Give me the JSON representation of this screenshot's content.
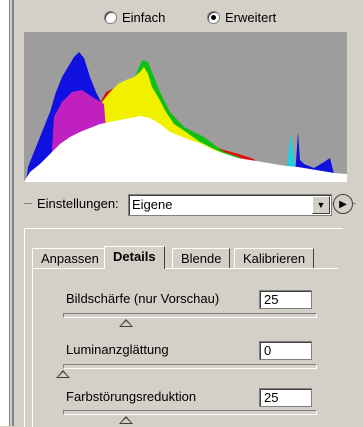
{
  "mode": {
    "options": [
      {
        "label": "Einfach",
        "selected": false
      },
      {
        "label": "Erweitert",
        "selected": true
      }
    ]
  },
  "histogram": {
    "channels": [
      "blue",
      "red",
      "green",
      "yellow",
      "cyan",
      "magenta",
      "white"
    ]
  },
  "settings": {
    "label": "Einstellungen:",
    "value": "Eigene",
    "menu_icon": "flyout-menu-icon"
  },
  "tabs": [
    {
      "label": "Anpassen",
      "active": false
    },
    {
      "label": "Details",
      "active": true
    },
    {
      "label": "Blende",
      "active": false
    },
    {
      "label": "Kalibrieren",
      "active": false
    }
  ],
  "controls": [
    {
      "label": "Bildschärfe (nur Vorschau)",
      "value": "25",
      "slider_value": 25,
      "slider_max": 100
    },
    {
      "label": "Luminanzglättung",
      "value": "0",
      "slider_value": 0,
      "slider_max": 100
    },
    {
      "label": "Farbstörungsreduktion",
      "value": "25",
      "slider_value": 25,
      "slider_max": 100
    }
  ]
}
